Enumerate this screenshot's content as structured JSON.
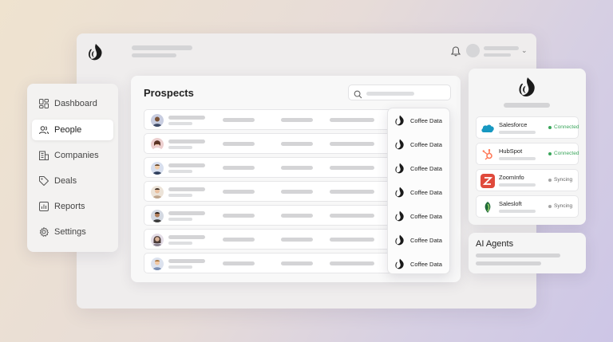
{
  "main": {
    "title": "Prospects",
    "rows_count_label": "",
    "coffee_label": "Coffee Data"
  },
  "sidebar": {
    "items": [
      {
        "label": "Dashboard",
        "icon": "dashboard-icon"
      },
      {
        "label": "People",
        "icon": "people-icon"
      },
      {
        "label": "Companies",
        "icon": "building-icon"
      },
      {
        "label": "Deals",
        "icon": "tag-icon"
      },
      {
        "label": "Reports",
        "icon": "chart-icon"
      },
      {
        "label": "Settings",
        "icon": "gear-icon"
      }
    ],
    "active": "People"
  },
  "integrations": [
    {
      "name": "Salesforce",
      "status": "Connected",
      "status_color": "#3aa65b"
    },
    {
      "name": "HubSpot",
      "status": "Connected",
      "status_color": "#3aa65b"
    },
    {
      "name": "ZoomInfo",
      "status": "Syncing",
      "status_color": "#9a9a9a"
    },
    {
      "name": "Salesloft",
      "status": "Syncing",
      "status_color": "#9a9a9a"
    }
  ],
  "ai": {
    "title": "AI Agents"
  },
  "colors": {
    "accent_connected": "#3aa65b",
    "placeholder": "#d4d4d6"
  }
}
